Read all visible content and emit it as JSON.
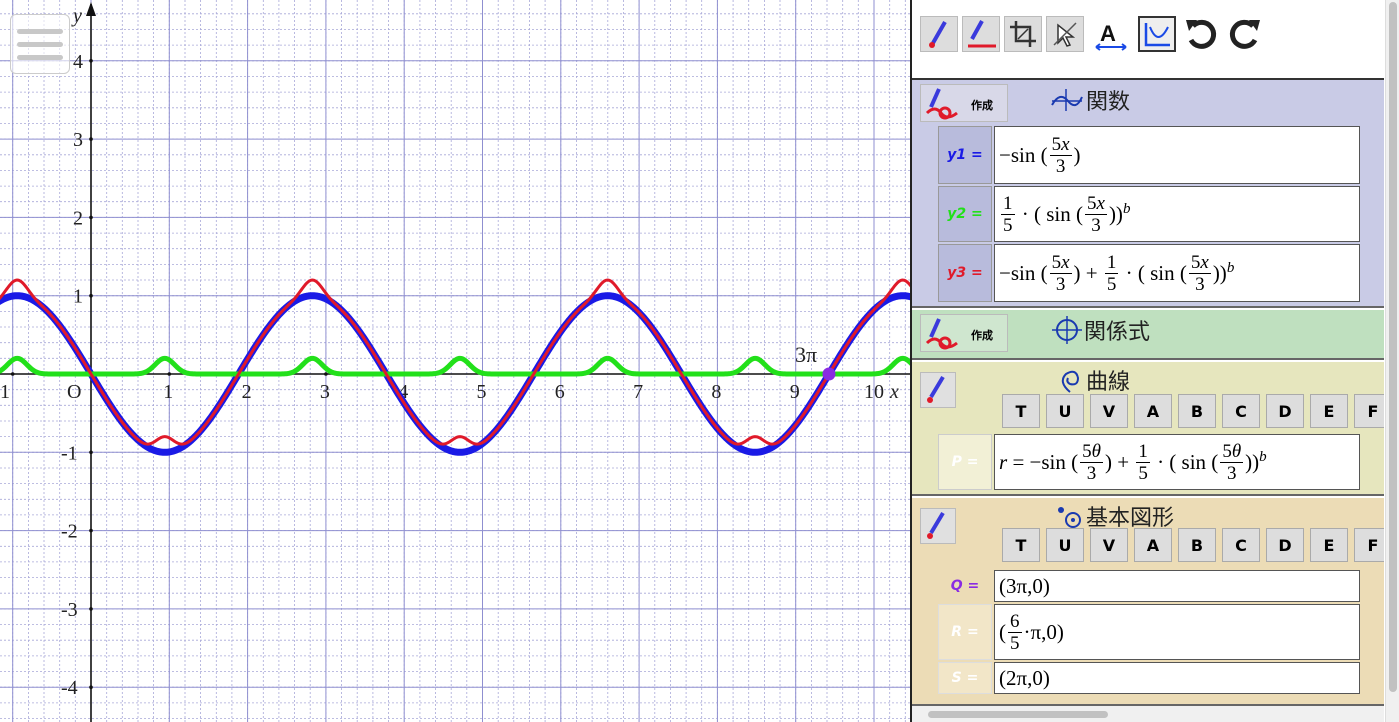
{
  "graph": {
    "x_ticks": [
      "1",
      "O",
      "1",
      "2",
      "3",
      "4",
      "5",
      "6",
      "7",
      "8",
      "9",
      "10"
    ],
    "y_ticks": [
      "4",
      "3",
      "2",
      "1",
      "-1",
      "-2",
      "-3",
      "-4"
    ],
    "x_axis_label": "x",
    "y_axis_label": "y",
    "point_label": "3π",
    "colors": {
      "y1": "#1a1ae6",
      "y2": "#22e01a",
      "y3": "#e01a2a",
      "point": "#8a2be2"
    }
  },
  "toolbar": {
    "tools": [
      "pen-red-icon",
      "pen-line-icon",
      "crop-icon",
      "pointer-icon",
      "text-size-icon",
      "graph-frame-icon",
      "undo-icon",
      "redo-icon"
    ]
  },
  "functions": {
    "make_label": "作成",
    "title": "関数",
    "rows": [
      {
        "label": "y1 =",
        "color": "#1a1ae6"
      },
      {
        "label": "y2 =",
        "color": "#22e01a"
      },
      {
        "label": "y3 =",
        "color": "#e01a2a"
      }
    ]
  },
  "relations": {
    "make_label": "作成",
    "title": "関係式"
  },
  "curves": {
    "title": "曲線",
    "letters": [
      "T",
      "U",
      "V",
      "A",
      "B",
      "C",
      "D",
      "E",
      "F"
    ],
    "row_label": "P ="
  },
  "basic": {
    "title": "基本図形",
    "letters": [
      "T",
      "U",
      "V",
      "A",
      "B",
      "C",
      "D",
      "E",
      "F"
    ],
    "rows": [
      {
        "label": "Q =",
        "value": "(3π,0)",
        "color": "#8a2be2"
      },
      {
        "label": "R =",
        "value_pre": "(",
        "value_post": "·π,0)"
      },
      {
        "label": "S =",
        "value": "(2π,0)"
      }
    ]
  }
}
